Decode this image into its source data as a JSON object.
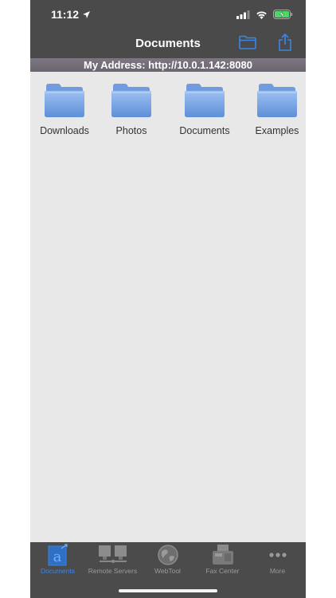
{
  "status_bar": {
    "time": "11:12"
  },
  "nav": {
    "title": "Documents"
  },
  "address": {
    "text": "My Address: http://10.0.1.142:8080"
  },
  "folders": [
    {
      "label": "Downloads"
    },
    {
      "label": "Photos"
    },
    {
      "label": "Documents"
    },
    {
      "label": "Examples"
    }
  ],
  "tabs": [
    {
      "label": "Documents",
      "icon": "documents-icon",
      "active": true
    },
    {
      "label": "Remote Servers",
      "icon": "servers-icon",
      "active": false
    },
    {
      "label": "WebTool",
      "icon": "globe-icon",
      "active": false
    },
    {
      "label": "Fax Center",
      "icon": "fax-icon",
      "active": false
    },
    {
      "label": "More",
      "icon": "more-icon",
      "active": false
    }
  ],
  "colors": {
    "accent": "#3a86e6",
    "bar_background": "#4a4a4a",
    "folder_blue": "#7aa6e6"
  }
}
